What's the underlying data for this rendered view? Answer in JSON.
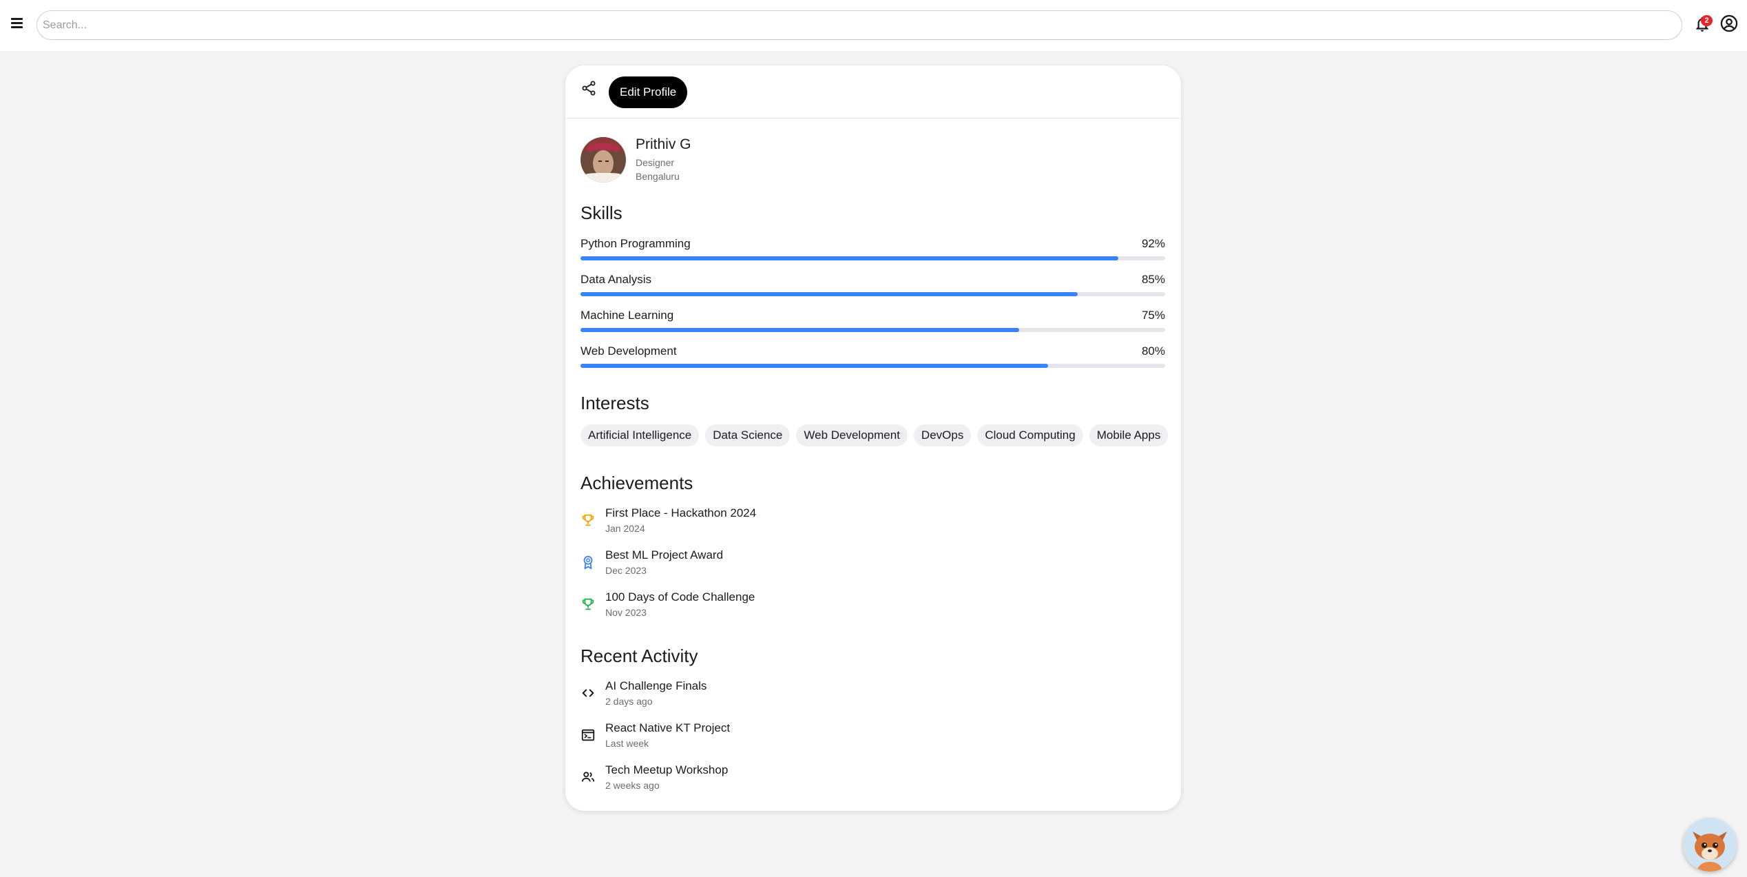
{
  "search": {
    "placeholder": "Search..."
  },
  "notifications": {
    "count": "2",
    "icon": "bell-icon"
  },
  "header": {
    "edit_label": "Edit Profile"
  },
  "profile": {
    "name": "Prithiv G",
    "role": "Designer",
    "location": "Bengaluru"
  },
  "sections": {
    "skills": "Skills",
    "interests": "Interests",
    "achievements": "Achievements",
    "activity": "Recent Activity"
  },
  "skills": [
    {
      "name": "Python Programming",
      "percent_label": "92%",
      "value": 0.92
    },
    {
      "name": "Data Analysis",
      "percent_label": "85%",
      "value": 0.85
    },
    {
      "name": "Machine Learning",
      "percent_label": "75%",
      "value": 0.75
    },
    {
      "name": "Web Development",
      "percent_label": "80%",
      "value": 0.8
    }
  ],
  "interests": [
    "Artificial Intelligence",
    "Data Science",
    "Web Development",
    "DevOps",
    "Cloud Computing",
    "Mobile Apps"
  ],
  "achievements": [
    {
      "title": "First Place - Hackathon 2024",
      "date": "Jan 2024",
      "icon": "trophy-icon",
      "color": "#f0a500"
    },
    {
      "title": "Best ML Project Award",
      "date": "Dec 2023",
      "icon": "award-badge-icon",
      "color": "#3a82f6"
    },
    {
      "title": "100 Days of Code Challenge",
      "date": "Nov 2023",
      "icon": "trophy-icon",
      "color": "#22b14c"
    }
  ],
  "activity": [
    {
      "title": "AI Challenge Finals",
      "time": "2 days ago",
      "icon": "code-icon"
    },
    {
      "title": "React Native KT Project",
      "time": "Last week",
      "icon": "terminal-icon"
    },
    {
      "title": "Tech Meetup Workshop",
      "time": "2 weeks ago",
      "icon": "people-icon"
    }
  ],
  "colors": {
    "accent": "#3a82f6",
    "badge": "#e3262b",
    "primary_button": "#000000"
  }
}
